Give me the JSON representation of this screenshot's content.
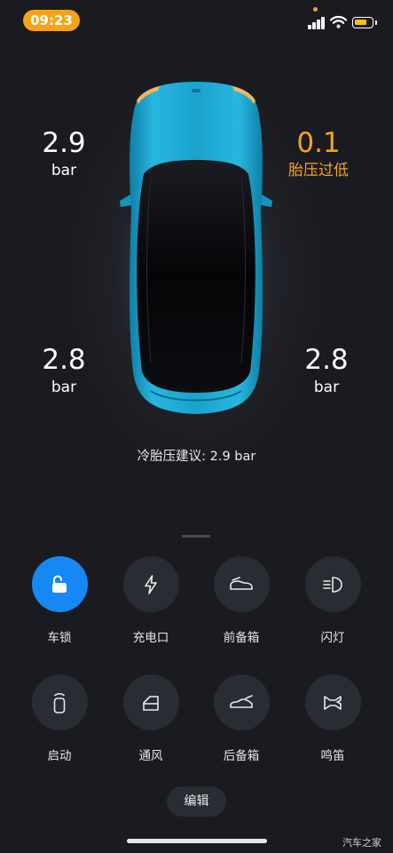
{
  "status_bar": {
    "time": "09:23",
    "accent_color": "#f6a319"
  },
  "car": {
    "body_color": "#1aa3cc"
  },
  "tires": {
    "front_left": {
      "value": "2.9",
      "unit": "bar"
    },
    "front_right": {
      "value": "0.1",
      "unit": "胎压过低",
      "warning": true
    },
    "rear_left": {
      "value": "2.8",
      "unit": "bar"
    },
    "rear_right": {
      "value": "2.8",
      "unit": "bar"
    }
  },
  "recommendation": "冷胎压建议: 2.9 bar",
  "controls": [
    {
      "label": "车锁",
      "icon": "unlock-icon",
      "active": true
    },
    {
      "label": "充电口",
      "icon": "lightning-icon",
      "active": false
    },
    {
      "label": "前备箱",
      "icon": "front-trunk-icon",
      "active": false
    },
    {
      "label": "闪灯",
      "icon": "headlight-icon",
      "active": false
    },
    {
      "label": "启动",
      "icon": "remote-start-icon",
      "active": false
    },
    {
      "label": "通风",
      "icon": "window-vent-icon",
      "active": false
    },
    {
      "label": "后备箱",
      "icon": "rear-trunk-icon",
      "active": false
    },
    {
      "label": "鸣笛",
      "icon": "horn-icon",
      "active": false
    }
  ],
  "edit_label": "编辑",
  "watermark": "汽车之家",
  "colors": {
    "background": "#1a1b20",
    "button": "#2a2c33",
    "active_button": "#1688f3",
    "warning": "#f6a319"
  }
}
